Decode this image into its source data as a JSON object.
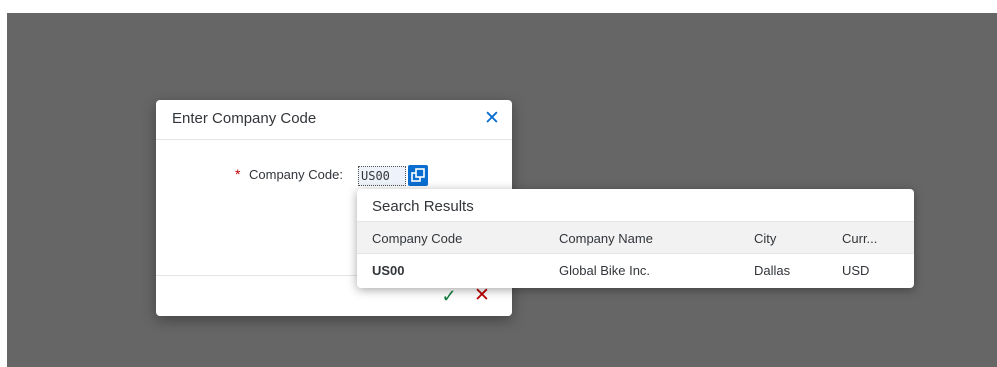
{
  "dialog": {
    "title": "Enter Company Code",
    "close_icon": "close-icon",
    "required_marker": "*",
    "field_label": "Company Code:",
    "field_value": "US00",
    "value_help_icon": "value-help-icon",
    "ok_icon": "checkmark-icon",
    "cancel_icon": "cancel-x-icon",
    "colors": {
      "accent": "#0a6ed1",
      "ok": "#107e3e",
      "cancel": "#bb0000",
      "overlay": "#666666"
    }
  },
  "search_results": {
    "title": "Search Results",
    "columns": [
      "Company Code",
      "Company Name",
      "City",
      "Curr..."
    ],
    "rows": [
      [
        "US00",
        "Global Bike Inc.",
        "Dallas",
        "USD"
      ]
    ]
  }
}
